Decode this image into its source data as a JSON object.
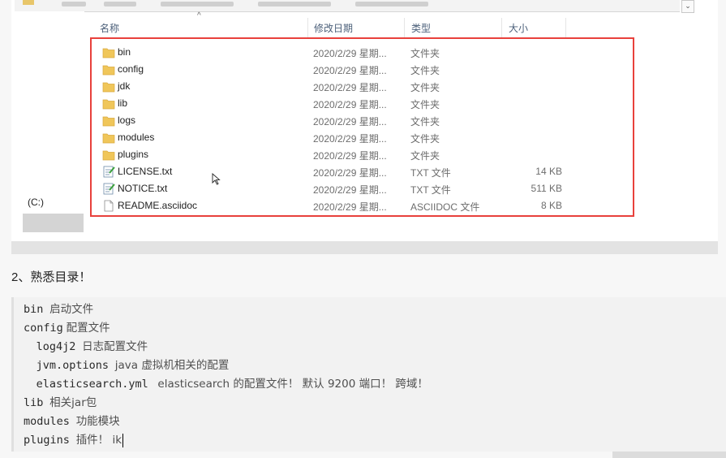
{
  "explorer": {
    "columns": [
      "名称",
      "修改日期",
      "类型",
      "大小"
    ],
    "sidebar_drive": "(C:)",
    "files": [
      {
        "name": "bin",
        "date": "2020/2/29 星期...",
        "type": "文件夹",
        "size": "",
        "icon": "folder-icon"
      },
      {
        "name": "config",
        "date": "2020/2/29 星期...",
        "type": "文件夹",
        "size": "",
        "icon": "folder-icon"
      },
      {
        "name": "jdk",
        "date": "2020/2/29 星期...",
        "type": "文件夹",
        "size": "",
        "icon": "folder-icon"
      },
      {
        "name": "lib",
        "date": "2020/2/29 星期...",
        "type": "文件夹",
        "size": "",
        "icon": "folder-icon"
      },
      {
        "name": "logs",
        "date": "2020/2/29 星期...",
        "type": "文件夹",
        "size": "",
        "icon": "folder-icon"
      },
      {
        "name": "modules",
        "date": "2020/2/29 星期...",
        "type": "文件夹",
        "size": "",
        "icon": "folder-icon"
      },
      {
        "name": "plugins",
        "date": "2020/2/29 星期...",
        "type": "文件夹",
        "size": "",
        "icon": "folder-icon"
      },
      {
        "name": "LICENSE.txt",
        "date": "2020/2/29 星期...",
        "type": "TXT 文件",
        "size": "14 KB",
        "icon": "text-file-icon"
      },
      {
        "name": "NOTICE.txt",
        "date": "2020/2/29 星期...",
        "type": "TXT 文件",
        "size": "511 KB",
        "icon": "text-file-icon"
      },
      {
        "name": "README.asciidoc",
        "date": "2020/2/29 星期...",
        "type": "ASCIIDOC 文件",
        "size": "8 KB",
        "icon": "file-icon"
      }
    ]
  },
  "doc": {
    "heading": "2、熟悉目录！",
    "lines": [
      {
        "key": "bin",
        "desc": "启动文件"
      },
      {
        "key": "config",
        "desc": "配置文件"
      },
      {
        "key": "log4j2",
        "desc": "日志配置文件"
      },
      {
        "key": "jvm.options",
        "desc": "java 虚拟机相关的配置"
      },
      {
        "key": "elasticsearch.yml",
        "desc": "elasticsearch 的配置文件！ 默认 9200 端口！ 跨域！"
      },
      {
        "key": "lib",
        "desc": "相关jar包"
      },
      {
        "key": "modules",
        "desc": "功能模块"
      },
      {
        "key": "plugins",
        "desc": "插件！ ik"
      }
    ]
  },
  "colors": {
    "highlight": "#e8413c",
    "folder": "#f0c65a",
    "header_text": "#4c607a"
  }
}
